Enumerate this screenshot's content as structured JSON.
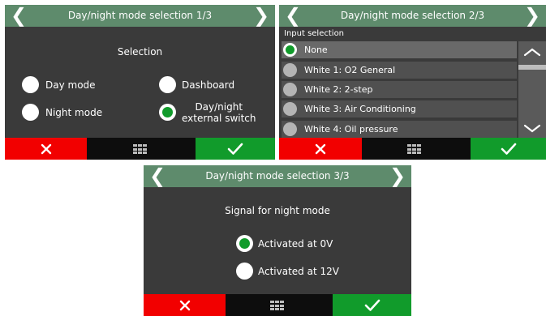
{
  "panel1": {
    "title": "Day/night mode selection 1/3",
    "heading": "Selection",
    "options": [
      {
        "label": "Day mode",
        "selected": false
      },
      {
        "label": "Dashboard",
        "selected": false
      },
      {
        "label": "Night mode",
        "selected": false
      },
      {
        "label_line1": "Day/night",
        "label_line2": "external switch",
        "selected": true
      }
    ]
  },
  "panel2": {
    "title": "Day/night mode selection 2/3",
    "subheading": "Input selection",
    "items": [
      {
        "label": "None",
        "selected": true
      },
      {
        "label": "White 1: O2 General",
        "selected": false
      },
      {
        "label": "White 2: 2-step",
        "selected": false
      },
      {
        "label": "White 3: Air Conditioning",
        "selected": false
      },
      {
        "label": "White 4: Oil pressure",
        "selected": false
      }
    ]
  },
  "panel3": {
    "title": "Day/night mode selection 3/3",
    "heading": "Signal for night mode",
    "options": [
      {
        "label": "Activated at 0V",
        "selected": true
      },
      {
        "label": "Activated at 12V",
        "selected": false
      }
    ]
  },
  "colors": {
    "titlebar": "#5e8b6c",
    "screen_bg": "#3a3a3a",
    "cancel": "#f20000",
    "confirm": "#119b2b",
    "bottom_bar": "#0d0d0d"
  },
  "icons": {
    "prev": "chevron-left-icon",
    "next": "chevron-right-icon",
    "cancel": "close-icon",
    "menu": "grid-menu-icon",
    "confirm": "checkmark-icon",
    "scroll_up": "chevron-up-icon",
    "scroll_down": "chevron-down-icon"
  }
}
